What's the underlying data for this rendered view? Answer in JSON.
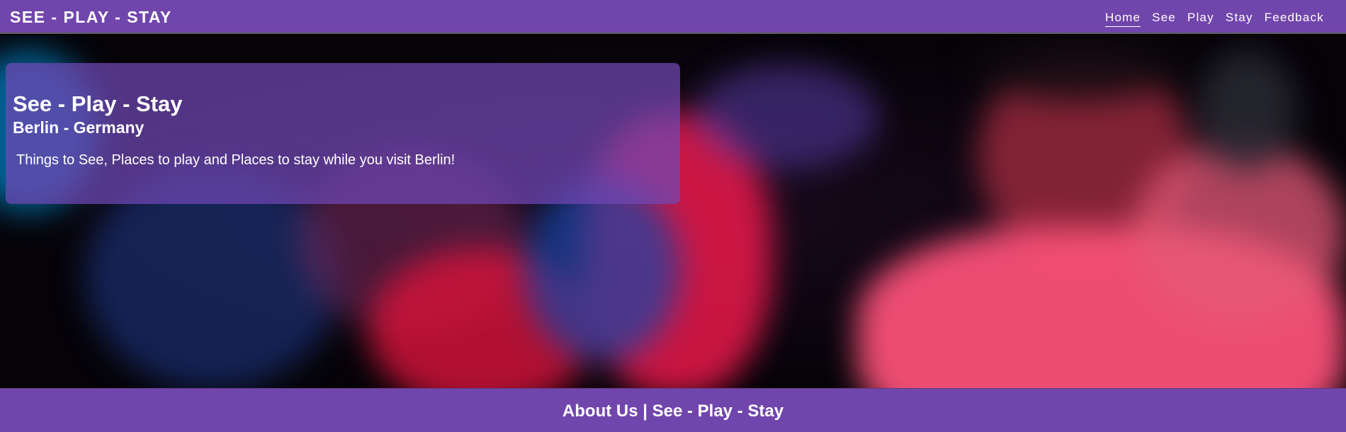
{
  "navbar": {
    "brand": "SEE - PLAY - STAY",
    "links": [
      {
        "label": "Home",
        "active": true
      },
      {
        "label": "See",
        "active": false
      },
      {
        "label": "Play",
        "active": false
      },
      {
        "label": "Stay",
        "active": false
      },
      {
        "label": "Feedback",
        "active": false
      }
    ]
  },
  "hero": {
    "title": "See - Play - Stay",
    "subtitle": "Berlin - Germany",
    "text": "Things to See, Places to play and Places to stay while you visit Berlin!"
  },
  "footer": {
    "text": "About Us | See - Play - Stay"
  },
  "colors": {
    "brand_purple": "#7146ac",
    "text": "#ffffff"
  }
}
